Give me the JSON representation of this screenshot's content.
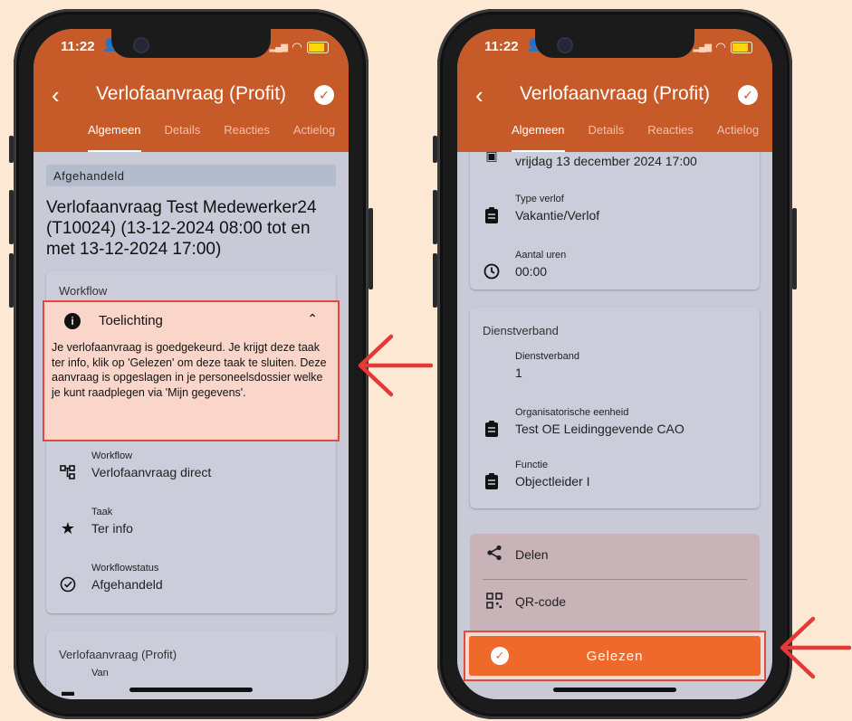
{
  "status_time": "11:22",
  "app_title": "Verlofaanvraag (Profit)",
  "tabs": [
    "Algemeen",
    "Details",
    "Reacties",
    "Actielog"
  ],
  "colors": {
    "brand": "#c75a29",
    "accent_button": "#ef6a2a",
    "highlight_border": "#e24a3e",
    "highlight_fill": "#f9d6c9",
    "arrow": "#e53935"
  },
  "left": {
    "state_label": "Afgehandeld",
    "heading": "Verlofaanvraag Test Medewerker24 (T10024) (13-12-2024 08:00 tot en met 13-12-2024 17:00)",
    "workflow_section": "Workflow",
    "toelichting_title": "Toelichting",
    "toelichting_text": "Je verlofaanvraag is goedgekeurd. Je krijgt deze taak ter info, klik op 'Gelezen' om deze taak te sluiten. Deze aanvraag is opgeslagen in je personeelsdossier welke je kunt raadplegen via 'Mijn gegevens'.",
    "rows": [
      {
        "label": "Workflow",
        "value": "Verlofaanvraag direct",
        "icon": "workflow-icon"
      },
      {
        "label": "Taak",
        "value": "Ter info",
        "icon": "star-icon"
      },
      {
        "label": "Workflowstatus",
        "value": "Afgehandeld",
        "icon": "check-circle-icon"
      }
    ],
    "verlof_section": "Verlofaanvraag (Profit)",
    "van_label": "Van"
  },
  "right": {
    "top_value": "vrijdag 13 december 2024 17:00",
    "rows": [
      {
        "label": "Type verlof",
        "value": "Vakantie/Verlof",
        "icon": "clipboard-icon"
      },
      {
        "label": "Aantal uren",
        "value": "00:00",
        "icon": "clock-icon"
      }
    ],
    "dienst_section": "Dienstverband",
    "dienst_rows": [
      {
        "label": "Dienstverband",
        "value": "1"
      },
      {
        "label": "Organisatorische eenheid",
        "value": "Test OE Leidinggevende CAO"
      },
      {
        "label": "Functie",
        "value": "Objectleider I"
      }
    ],
    "share_label": "Delen",
    "qr_label": "QR-code",
    "gelezen_label": "Gelezen"
  }
}
